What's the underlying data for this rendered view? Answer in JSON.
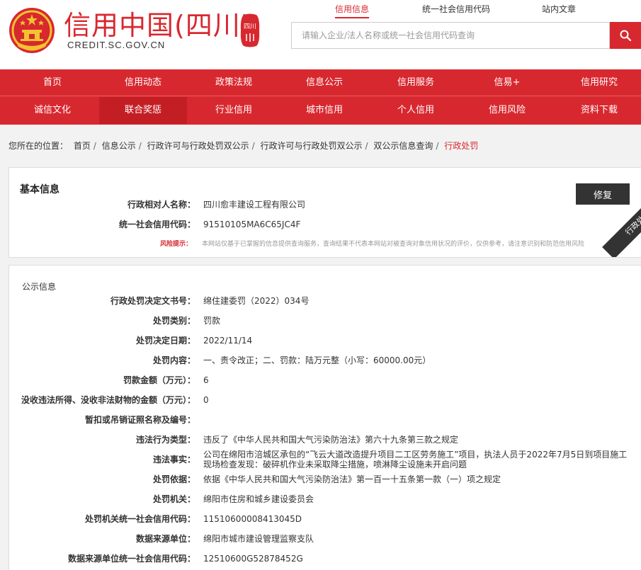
{
  "header": {
    "site_title": "信用中国(四川)",
    "site_domain": "CREDIT.SC.GOV.CN",
    "seal_text": "四川",
    "top_links": [
      "信用信息",
      "统一社会信用代码",
      "站内文章"
    ],
    "search_placeholder": "请输入企业/法人名称或统一社会信用代码查询",
    "accent": "#d8282f"
  },
  "nav": {
    "row1": [
      "首页",
      "信用动态",
      "政策法规",
      "信息公示",
      "信用服务",
      "信易+",
      "信用研究"
    ],
    "row2": [
      "诚信文化",
      "联合奖惩",
      "行业信用",
      "城市信用",
      "个人信用",
      "信用风险",
      "资料下载"
    ]
  },
  "breadcrumb": {
    "prefix": "您所在的位置：",
    "items": [
      "首页",
      "信息公示",
      "行政许可与行政处罚双公示",
      "行政许可与行政处罚双公示",
      "双公示信息查询",
      "行政处罚"
    ]
  },
  "basic": {
    "title": "基本信息",
    "repair_label": "修复",
    "ribbon": "行政处罚",
    "fields": [
      {
        "label": "行政相对人名称：",
        "value": "四川愈丰建设工程有限公司"
      },
      {
        "label": "统一社会信用代码：",
        "value": "91510105MA6C65JC4F"
      }
    ],
    "risk_label": "风险提示：",
    "risk_text": "本网站仅基于已掌握的信息提供查询服务，查询结果不代表本网站对被查询对象信用状况的评价，仅供参考，请注意识别和防范信用风险"
  },
  "public": {
    "title": "公示信息",
    "fields": [
      {
        "label": "行政处罚决定文书号：",
        "value": "绵住建委罚（2022）034号"
      },
      {
        "label": "处罚类别：",
        "value": "罚款"
      },
      {
        "label": "处罚决定日期：",
        "value": "2022/11/14"
      },
      {
        "label": "处罚内容：",
        "value": "一、责令改正；二、罚款：陆万元整（小写：60000.00元）"
      },
      {
        "label": "罚款金额（万元）：",
        "value": "6"
      },
      {
        "label": "没收违法所得、没收非法财物的金额（万元）：",
        "value": "0"
      },
      {
        "label": "暂扣或吊销证照名称及编号：",
        "value": ""
      },
      {
        "label": "违法行为类型：",
        "value": "违反了《中华人民共和国大气污染防治法》第六十九条第三款之规定"
      },
      {
        "label": "违法事实：",
        "value": "公司在绵阳市涪城区承包的“飞云大道改造提升项目二工区劳务施工”项目，执法人员于2022年7月5日到项目施工现场检查发现：破碎机作业未采取降尘措施，喷淋降尘设施未开启问题"
      },
      {
        "label": "处罚依据：",
        "value": "依据《中华人民共和国大气污染防治法》第一百一十五条第一款（一）项之规定"
      },
      {
        "label": "处罚机关：",
        "value": "绵阳市住房和城乡建设委员会"
      },
      {
        "label": "处罚机关统一社会信用代码：",
        "value": "11510600008413045D"
      },
      {
        "label": "数据来源单位：",
        "value": "绵阳市城市建设管理监察支队"
      },
      {
        "label": "数据来源单位统一社会信用代码：",
        "value": "12510600G52878452G"
      }
    ]
  }
}
